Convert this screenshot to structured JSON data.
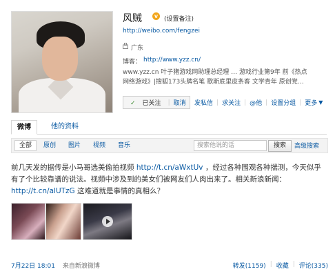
{
  "profile": {
    "name": "风贼",
    "verified_badge": "v",
    "remark": "(设置备注)",
    "url": "http://weibo.com/fengzei",
    "location": "广东",
    "blog_label": "博客：",
    "blog_url": "http://www.yzz.cn/",
    "bio_line1": "www.yzz.cn 叶子猪游戏网助理总经理 … 游戏行业第9年 前《热点",
    "bio_line2": "网络游戏》|搜狐173头牌名笔 歌斯底里皮条客 文学青年 原创党…"
  },
  "follow": {
    "followed_label": "已关注",
    "cancel_label": "取消",
    "actions": [
      "发私信",
      "求关注",
      "@他",
      "设置分组",
      "更多"
    ]
  },
  "tabs": [
    "微博",
    "他的资料"
  ],
  "filters": {
    "items": [
      "全部",
      "原创",
      "图片",
      "视频",
      "音乐"
    ],
    "search_placeholder": "搜索他说的话",
    "search_button": "搜索",
    "advanced": "高级搜索"
  },
  "post": {
    "text1": "前几天发的据传是小马哥选美偷拍视频 ",
    "link1": "http://t.cn/aWxtUv",
    "text2": " ，经过各种围观各种揣测，今天似乎有了个比较靠谱的说法。视频中涉及到的美女们被网友们人肉出来了。相关新浪新闻：",
    "link2": "http://t.cn/alUTzG",
    "text3": " 这难道就是事情的真相么？",
    "date": "7月22日 18:01",
    "source": "来自新浪微博",
    "forward": "转发(1159)",
    "favorite": "收藏",
    "comment": "评论(335)"
  },
  "colors": {
    "link": "#0a5aa3",
    "badge": "#f2a61c"
  }
}
